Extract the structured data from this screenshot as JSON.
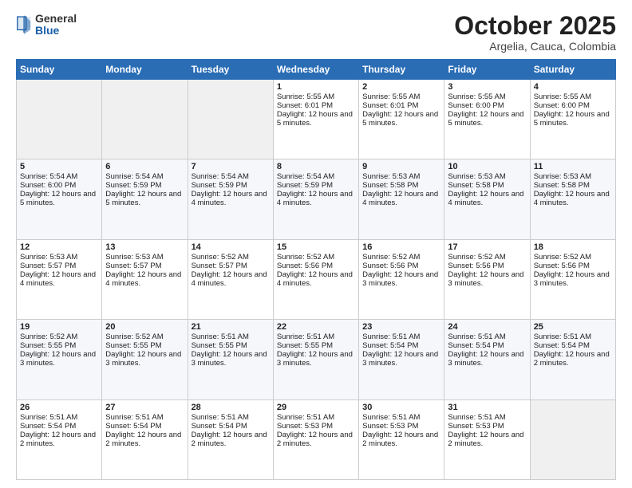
{
  "header": {
    "logo_general": "General",
    "logo_blue": "Blue",
    "month_title": "October 2025",
    "subtitle": "Argelia, Cauca, Colombia"
  },
  "days_of_week": [
    "Sunday",
    "Monday",
    "Tuesday",
    "Wednesday",
    "Thursday",
    "Friday",
    "Saturday"
  ],
  "weeks": [
    [
      {
        "day": "",
        "info": ""
      },
      {
        "day": "",
        "info": ""
      },
      {
        "day": "",
        "info": ""
      },
      {
        "day": "1",
        "sunrise": "Sunrise: 5:55 AM",
        "sunset": "Sunset: 6:01 PM",
        "daylight": "Daylight: 12 hours and 5 minutes."
      },
      {
        "day": "2",
        "sunrise": "Sunrise: 5:55 AM",
        "sunset": "Sunset: 6:01 PM",
        "daylight": "Daylight: 12 hours and 5 minutes."
      },
      {
        "day": "3",
        "sunrise": "Sunrise: 5:55 AM",
        "sunset": "Sunset: 6:00 PM",
        "daylight": "Daylight: 12 hours and 5 minutes."
      },
      {
        "day": "4",
        "sunrise": "Sunrise: 5:55 AM",
        "sunset": "Sunset: 6:00 PM",
        "daylight": "Daylight: 12 hours and 5 minutes."
      }
    ],
    [
      {
        "day": "5",
        "sunrise": "Sunrise: 5:54 AM",
        "sunset": "Sunset: 6:00 PM",
        "daylight": "Daylight: 12 hours and 5 minutes."
      },
      {
        "day": "6",
        "sunrise": "Sunrise: 5:54 AM",
        "sunset": "Sunset: 5:59 PM",
        "daylight": "Daylight: 12 hours and 5 minutes."
      },
      {
        "day": "7",
        "sunrise": "Sunrise: 5:54 AM",
        "sunset": "Sunset: 5:59 PM",
        "daylight": "Daylight: 12 hours and 4 minutes."
      },
      {
        "day": "8",
        "sunrise": "Sunrise: 5:54 AM",
        "sunset": "Sunset: 5:59 PM",
        "daylight": "Daylight: 12 hours and 4 minutes."
      },
      {
        "day": "9",
        "sunrise": "Sunrise: 5:53 AM",
        "sunset": "Sunset: 5:58 PM",
        "daylight": "Daylight: 12 hours and 4 minutes."
      },
      {
        "day": "10",
        "sunrise": "Sunrise: 5:53 AM",
        "sunset": "Sunset: 5:58 PM",
        "daylight": "Daylight: 12 hours and 4 minutes."
      },
      {
        "day": "11",
        "sunrise": "Sunrise: 5:53 AM",
        "sunset": "Sunset: 5:58 PM",
        "daylight": "Daylight: 12 hours and 4 minutes."
      }
    ],
    [
      {
        "day": "12",
        "sunrise": "Sunrise: 5:53 AM",
        "sunset": "Sunset: 5:57 PM",
        "daylight": "Daylight: 12 hours and 4 minutes."
      },
      {
        "day": "13",
        "sunrise": "Sunrise: 5:53 AM",
        "sunset": "Sunset: 5:57 PM",
        "daylight": "Daylight: 12 hours and 4 minutes."
      },
      {
        "day": "14",
        "sunrise": "Sunrise: 5:52 AM",
        "sunset": "Sunset: 5:57 PM",
        "daylight": "Daylight: 12 hours and 4 minutes."
      },
      {
        "day": "15",
        "sunrise": "Sunrise: 5:52 AM",
        "sunset": "Sunset: 5:56 PM",
        "daylight": "Daylight: 12 hours and 4 minutes."
      },
      {
        "day": "16",
        "sunrise": "Sunrise: 5:52 AM",
        "sunset": "Sunset: 5:56 PM",
        "daylight": "Daylight: 12 hours and 3 minutes."
      },
      {
        "day": "17",
        "sunrise": "Sunrise: 5:52 AM",
        "sunset": "Sunset: 5:56 PM",
        "daylight": "Daylight: 12 hours and 3 minutes."
      },
      {
        "day": "18",
        "sunrise": "Sunrise: 5:52 AM",
        "sunset": "Sunset: 5:56 PM",
        "daylight": "Daylight: 12 hours and 3 minutes."
      }
    ],
    [
      {
        "day": "19",
        "sunrise": "Sunrise: 5:52 AM",
        "sunset": "Sunset: 5:55 PM",
        "daylight": "Daylight: 12 hours and 3 minutes."
      },
      {
        "day": "20",
        "sunrise": "Sunrise: 5:52 AM",
        "sunset": "Sunset: 5:55 PM",
        "daylight": "Daylight: 12 hours and 3 minutes."
      },
      {
        "day": "21",
        "sunrise": "Sunrise: 5:51 AM",
        "sunset": "Sunset: 5:55 PM",
        "daylight": "Daylight: 12 hours and 3 minutes."
      },
      {
        "day": "22",
        "sunrise": "Sunrise: 5:51 AM",
        "sunset": "Sunset: 5:55 PM",
        "daylight": "Daylight: 12 hours and 3 minutes."
      },
      {
        "day": "23",
        "sunrise": "Sunrise: 5:51 AM",
        "sunset": "Sunset: 5:54 PM",
        "daylight": "Daylight: 12 hours and 3 minutes."
      },
      {
        "day": "24",
        "sunrise": "Sunrise: 5:51 AM",
        "sunset": "Sunset: 5:54 PM",
        "daylight": "Daylight: 12 hours and 3 minutes."
      },
      {
        "day": "25",
        "sunrise": "Sunrise: 5:51 AM",
        "sunset": "Sunset: 5:54 PM",
        "daylight": "Daylight: 12 hours and 2 minutes."
      }
    ],
    [
      {
        "day": "26",
        "sunrise": "Sunrise: 5:51 AM",
        "sunset": "Sunset: 5:54 PM",
        "daylight": "Daylight: 12 hours and 2 minutes."
      },
      {
        "day": "27",
        "sunrise": "Sunrise: 5:51 AM",
        "sunset": "Sunset: 5:54 PM",
        "daylight": "Daylight: 12 hours and 2 minutes."
      },
      {
        "day": "28",
        "sunrise": "Sunrise: 5:51 AM",
        "sunset": "Sunset: 5:54 PM",
        "daylight": "Daylight: 12 hours and 2 minutes."
      },
      {
        "day": "29",
        "sunrise": "Sunrise: 5:51 AM",
        "sunset": "Sunset: 5:53 PM",
        "daylight": "Daylight: 12 hours and 2 minutes."
      },
      {
        "day": "30",
        "sunrise": "Sunrise: 5:51 AM",
        "sunset": "Sunset: 5:53 PM",
        "daylight": "Daylight: 12 hours and 2 minutes."
      },
      {
        "day": "31",
        "sunrise": "Sunrise: 5:51 AM",
        "sunset": "Sunset: 5:53 PM",
        "daylight": "Daylight: 12 hours and 2 minutes."
      },
      {
        "day": "",
        "info": ""
      }
    ]
  ]
}
